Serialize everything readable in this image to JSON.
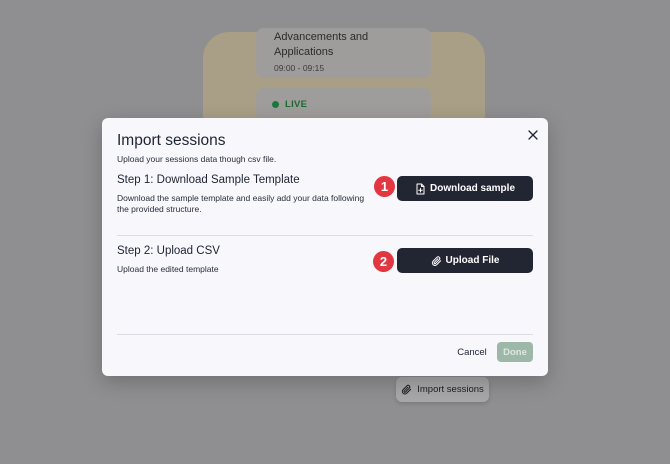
{
  "background": {
    "session": {
      "title_line1": "Advancements and",
      "title_line2": "Applications",
      "time": "09:00 - 09:15"
    },
    "live_label": "LIVE",
    "import_button_label": "Import sessions"
  },
  "modal": {
    "title": "Import sessions",
    "subtitle": "Upload your sessions data though csv file.",
    "step1": {
      "title": "Step 1: Download Sample Template",
      "description": "Download the sample template and easily add your data following the provided structure.",
      "badge": "1",
      "button_label": "Download sample",
      "button_icon": "file-plus-icon"
    },
    "step2": {
      "title": "Step 2: Upload CSV",
      "description": "Upload the edited template",
      "badge": "2",
      "button_label": "Upload File",
      "button_icon": "paperclip-icon"
    },
    "footer": {
      "cancel_label": "Cancel",
      "done_label": "Done"
    }
  },
  "colors": {
    "primary_button": "#222632",
    "badge": "#e23641",
    "done_disabled": "#9db8a9",
    "live": "#1b7a3a"
  }
}
